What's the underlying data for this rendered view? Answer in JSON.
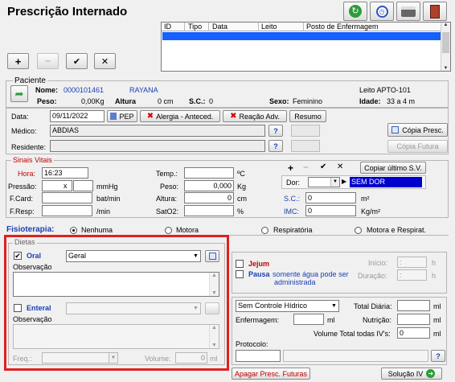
{
  "header": {
    "title": "Prescrição Internado",
    "toolbar": [
      "add",
      "remove",
      "confirm",
      "cancel"
    ],
    "top_icons": [
      "refresh-icon",
      "timer-icon",
      "printer-icon",
      "exit-door-icon"
    ]
  },
  "grid": {
    "columns": [
      "ID",
      "Tipo",
      "Data",
      "Leito",
      "Posto de Enfermagem"
    ]
  },
  "paciente": {
    "legend": "Paciente",
    "nome_label": "Nome:",
    "nome_codigo": "0000101461",
    "nome": "RAYANA",
    "leito": "Leito APTO-101",
    "peso_label": "Peso:",
    "peso": "0,00Kg",
    "altura_label": "Altura",
    "altura": "0  cm",
    "sc_label": "S.C.:",
    "sc": "0",
    "sexo_label": "Sexo:",
    "sexo": "Feminino",
    "idade_label": "Idade:",
    "idade": "33 a 4 m"
  },
  "consulta": {
    "data_label": "Data:",
    "data": "09/11/2022",
    "pep_label": "PEP",
    "alergia_label": "Alergia - Anteced.",
    "reacao_label": "Reação Adv.",
    "resumo_label": "Resumo",
    "medico_label": "Médico:",
    "medico": "ABDIAS",
    "residente_label": "Residente:",
    "residente": "",
    "copia_presc_label": "Cópia Presc.",
    "copia_futura_label": "Cópia Futura"
  },
  "sinais": {
    "legend": "Sinais Vitais",
    "hora_label": "Hora:",
    "hora": "16:23",
    "pressao_label": "Pressão:",
    "pressao_x": "x",
    "pressao_unit": "mmHg",
    "fcard_label": "F.Card:",
    "fcard_unit": "bat/min",
    "fresp_label": "F.Resp:",
    "fresp_unit": "/min",
    "temp_label": "Temp.:",
    "temp_unit": "ºC",
    "peso_label": "Peso:",
    "peso": "0,000",
    "peso_unit": "Kg",
    "altura_label": "Altura:",
    "altura": "0",
    "altura_unit": "cm",
    "sato2_label": "SatO2:",
    "sato2_unit": "%",
    "copiar_label": "Copiar último S.V.",
    "dor_label": "Dor:",
    "dor_value": "SEM DOR",
    "sc_label": "S.C.:",
    "sc": "0",
    "sc_unit": "m²",
    "imc_label": "IMC:",
    "imc": "0",
    "imc_unit": "Kg/m²"
  },
  "fisioterapia": {
    "label": "Fisioterapia:",
    "options": [
      "Nenhuma",
      "Motora",
      "Respiratória",
      "Motora e Respirat."
    ],
    "selected": "Nenhuma"
  },
  "dietas": {
    "legend": "Dietas",
    "oral_label": "Oral",
    "oral_checked": true,
    "oral_value": "Geral",
    "obs_label": "Observação",
    "enteral_label": "Enteral",
    "enteral_checked": false,
    "obs2_label": "Observação",
    "freq_label": "Freq.:",
    "volume_label": "Volume:",
    "volume": "0",
    "volume_unit": "ml"
  },
  "jejum": {
    "jejum_label": "Jejum",
    "pausa_label": "Pausa",
    "pausa_text1": "somente água pode ser",
    "pausa_text2": "administrada",
    "inicio_label": "Início:",
    "inicio": ":",
    "duracao_label": "Duração:",
    "duracao": ":",
    "h": "h"
  },
  "hidrico": {
    "controle": "Sem Controle Hídrico",
    "total_diaria_label": "Total Diária:",
    "enfermagem_label": "Enfermagem:",
    "nutricao_label": "Nutrição:",
    "volume_total_label": "Volume Total todas IV's:",
    "volume_total": "0",
    "ml": "ml",
    "protocolo_label": "Protocolo:"
  },
  "footer": {
    "apagar_label": "Apagar Presc. Futuras",
    "solucao_label": "Solução IV"
  },
  "colors": {
    "red_label": "#c00000",
    "blue_text": "#1a3fb3",
    "highlight_border": "#e02020",
    "dor_bg": "#0000cc"
  }
}
